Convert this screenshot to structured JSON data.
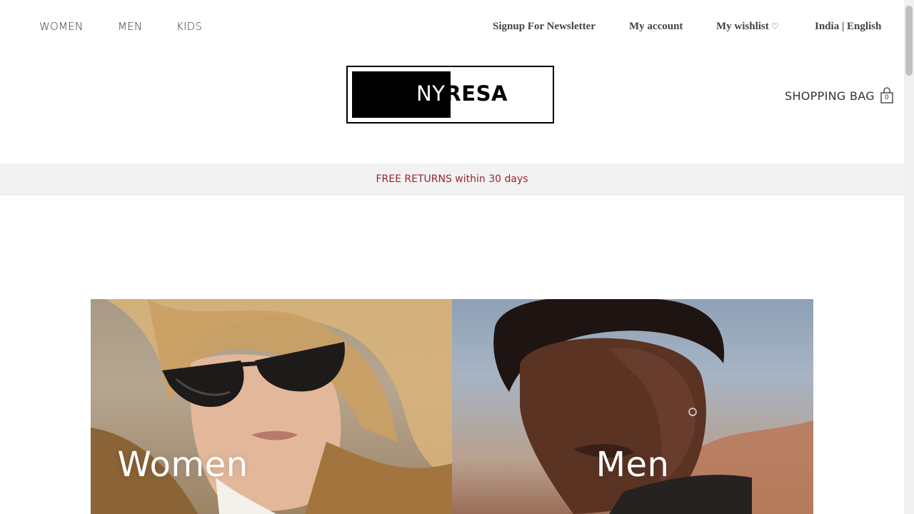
{
  "nav": {
    "left": [
      {
        "label": "WOMEN"
      },
      {
        "label": "MEN"
      },
      {
        "label": "KIDS"
      }
    ],
    "right": {
      "newsletter": "Signup For Newsletter",
      "account": "My account",
      "wishlist": "My wishlist",
      "wishlist_icon": "heart-outline-icon",
      "locale": "India | English"
    }
  },
  "logo": {
    "part1": "NY",
    "part2": "RESA"
  },
  "bag": {
    "label": "SHOPPING BAG",
    "count": "0",
    "icon": "shopping-bag-icon"
  },
  "promo": {
    "text": "FREE RETURNS within 30 days",
    "color": "#9b2335"
  },
  "hero": {
    "panels": [
      {
        "title": "Women"
      },
      {
        "title": "Men"
      }
    ]
  }
}
